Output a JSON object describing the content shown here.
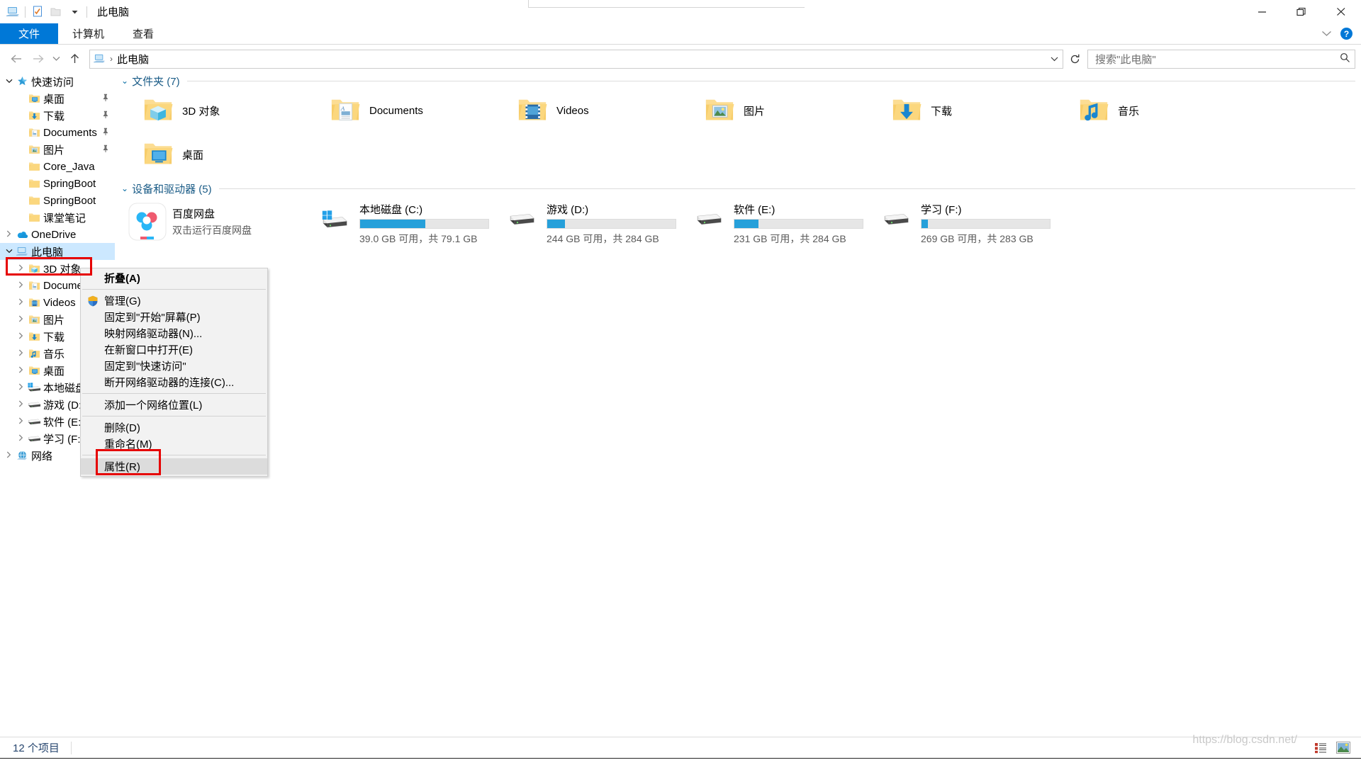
{
  "window": {
    "title": "此电脑",
    "quick_access_icons": [
      "this-pc-icon",
      "properties-icon",
      "new-folder-icon",
      "dropdown-caret-icon"
    ],
    "controls": {
      "minimize": "—",
      "maximize": "❐",
      "close": "✕"
    }
  },
  "ribbon": {
    "tabs": [
      {
        "label": "文件",
        "active": true
      },
      {
        "label": "计算机",
        "active": false
      },
      {
        "label": "查看",
        "active": false
      }
    ],
    "collapse_caret": "⌄",
    "help_label": "?"
  },
  "navbar": {
    "back": "←",
    "forward": "→",
    "recent": "⌄",
    "up": "↑",
    "breadcrumb_icon": "this-pc-icon",
    "breadcrumb_sep": "›",
    "breadcrumb_text": "此电脑",
    "address_dropdown": "⌄",
    "refresh": "↻",
    "search_placeholder": "搜索\"此电脑\""
  },
  "sidebar": {
    "items": [
      {
        "label": "快速访问",
        "icon": "star-icon",
        "indent": 0,
        "chevron": "open",
        "pinned": false,
        "selected": false
      },
      {
        "label": "桌面",
        "icon": "desktop-folder-icon",
        "indent": 1,
        "chevron": "none",
        "pinned": true,
        "selected": false
      },
      {
        "label": "下载",
        "icon": "downloads-folder-icon",
        "indent": 1,
        "chevron": "none",
        "pinned": true,
        "selected": false
      },
      {
        "label": "Documents",
        "icon": "documents-folder-icon",
        "indent": 1,
        "chevron": "none",
        "pinned": true,
        "selected": false
      },
      {
        "label": "图片",
        "icon": "pictures-folder-icon",
        "indent": 1,
        "chevron": "none",
        "pinned": true,
        "selected": false
      },
      {
        "label": "Core_Java",
        "icon": "folder-icon",
        "indent": 1,
        "chevron": "none",
        "pinned": false,
        "selected": false
      },
      {
        "label": "SpringBoot",
        "icon": "folder-icon",
        "indent": 1,
        "chevron": "none",
        "pinned": false,
        "selected": false
      },
      {
        "label": "SpringBoot",
        "icon": "folder-icon",
        "indent": 1,
        "chevron": "none",
        "pinned": false,
        "selected": false
      },
      {
        "label": "课堂笔记",
        "icon": "folder-icon",
        "indent": 1,
        "chevron": "none",
        "pinned": false,
        "selected": false
      },
      {
        "label": "OneDrive",
        "icon": "onedrive-icon",
        "indent": 0,
        "chevron": "closed",
        "pinned": false,
        "selected": false
      },
      {
        "label": "此电脑",
        "icon": "this-pc-icon",
        "indent": 0,
        "chevron": "open",
        "pinned": false,
        "selected": true
      },
      {
        "label": "3D 对象",
        "icon": "3d-objects-icon",
        "indent": 1,
        "chevron": "closed",
        "pinned": false,
        "selected": false
      },
      {
        "label": "Documents",
        "icon": "documents-folder-icon",
        "indent": 1,
        "chevron": "closed",
        "pinned": false,
        "selected": false
      },
      {
        "label": "Videos",
        "icon": "videos-folder-icon",
        "indent": 1,
        "chevron": "closed",
        "pinned": false,
        "selected": false
      },
      {
        "label": "图片",
        "icon": "pictures-folder-icon",
        "indent": 1,
        "chevron": "closed",
        "pinned": false,
        "selected": false
      },
      {
        "label": "下载",
        "icon": "downloads-folder-icon",
        "indent": 1,
        "chevron": "closed",
        "pinned": false,
        "selected": false
      },
      {
        "label": "音乐",
        "icon": "music-folder-icon",
        "indent": 1,
        "chevron": "closed",
        "pinned": false,
        "selected": false
      },
      {
        "label": "桌面",
        "icon": "desktop-folder-icon",
        "indent": 1,
        "chevron": "closed",
        "pinned": false,
        "selected": false
      },
      {
        "label": "本地磁盘 (C:)",
        "icon": "windows-drive-icon",
        "indent": 1,
        "chevron": "closed",
        "pinned": false,
        "selected": false
      },
      {
        "label": "游戏 (D:)",
        "icon": "drive-icon",
        "indent": 1,
        "chevron": "closed",
        "pinned": false,
        "selected": false
      },
      {
        "label": "软件 (E:)",
        "icon": "drive-icon",
        "indent": 1,
        "chevron": "closed",
        "pinned": false,
        "selected": false
      },
      {
        "label": "学习 (F:)",
        "icon": "drive-icon",
        "indent": 1,
        "chevron": "closed",
        "pinned": false,
        "selected": false
      },
      {
        "label": "网络",
        "icon": "network-icon",
        "indent": 0,
        "chevron": "closed",
        "pinned": false,
        "selected": false
      }
    ]
  },
  "content": {
    "folders_group": {
      "title": "文件夹 (7)",
      "chevron": "⌄",
      "items": [
        {
          "label": "3D 对象",
          "icon": "3d-objects-folder-icon"
        },
        {
          "label": "Documents",
          "icon": "documents-folder-icon"
        },
        {
          "label": "Videos",
          "icon": "videos-folder-icon"
        },
        {
          "label": "图片",
          "icon": "pictures-folder-icon"
        },
        {
          "label": "下载",
          "icon": "downloads-folder-icon"
        },
        {
          "label": "音乐",
          "icon": "music-folder-icon"
        },
        {
          "label": "桌面",
          "icon": "desktop-folder-icon"
        }
      ]
    },
    "drives_group": {
      "title": "设备和驱动器 (5)",
      "chevron": "⌄",
      "app": {
        "name": "百度网盘",
        "subtitle": "双击运行百度网盘",
        "icon": "baidu-netdisk-icon"
      },
      "drives": [
        {
          "name": "本地磁盘 (C:)",
          "free_text": "39.0 GB 可用，共 79.1 GB",
          "used_percent": 51,
          "icon": "windows-drive-icon",
          "bar_color": "#26a0da"
        },
        {
          "name": "游戏 (D:)",
          "free_text": "244 GB 可用，共 284 GB",
          "used_percent": 14,
          "icon": "drive-icon",
          "bar_color": "#26a0da"
        },
        {
          "name": "软件 (E:)",
          "free_text": "231 GB 可用，共 284 GB",
          "used_percent": 19,
          "icon": "drive-icon",
          "bar_color": "#26a0da"
        },
        {
          "name": "学习 (F:)",
          "free_text": "269 GB 可用，共 283 GB",
          "used_percent": 5,
          "icon": "drive-icon",
          "bar_color": "#26a0da"
        }
      ]
    }
  },
  "context_menu": {
    "items": [
      {
        "label": "折叠(A)",
        "bold": true,
        "icon": null,
        "selected": false,
        "sep_after": true
      },
      {
        "label": "管理(G)",
        "bold": false,
        "icon": "shield-icon",
        "selected": false,
        "sep_after": false
      },
      {
        "label": "固定到\"开始\"屏幕(P)",
        "bold": false,
        "icon": null,
        "selected": false,
        "sep_after": false
      },
      {
        "label": "映射网络驱动器(N)...",
        "bold": false,
        "icon": null,
        "selected": false,
        "sep_after": false
      },
      {
        "label": "在新窗口中打开(E)",
        "bold": false,
        "icon": null,
        "selected": false,
        "sep_after": false
      },
      {
        "label": "固定到\"快速访问\"",
        "bold": false,
        "icon": null,
        "selected": false,
        "sep_after": false
      },
      {
        "label": "断开网络驱动器的连接(C)...",
        "bold": false,
        "icon": null,
        "selected": false,
        "sep_after": true
      },
      {
        "label": "添加一个网络位置(L)",
        "bold": false,
        "icon": null,
        "selected": false,
        "sep_after": true
      },
      {
        "label": "删除(D)",
        "bold": false,
        "icon": null,
        "selected": false,
        "sep_after": false
      },
      {
        "label": "重命名(M)",
        "bold": false,
        "icon": null,
        "selected": false,
        "sep_after": true
      },
      {
        "label": "属性(R)",
        "bold": false,
        "icon": null,
        "selected": true,
        "sep_after": false
      }
    ]
  },
  "statusbar": {
    "item_count": "12 个项目",
    "watermark": "https://blog.csdn.net/",
    "view_buttons": [
      "details-view-icon",
      "large-icons-view-icon"
    ]
  },
  "colors": {
    "accent": "#0078d7",
    "drive_bar": "#26a0da",
    "selection": "#cce8ff",
    "highlight_box": "#e60000",
    "group_title": "#1b5c87"
  }
}
